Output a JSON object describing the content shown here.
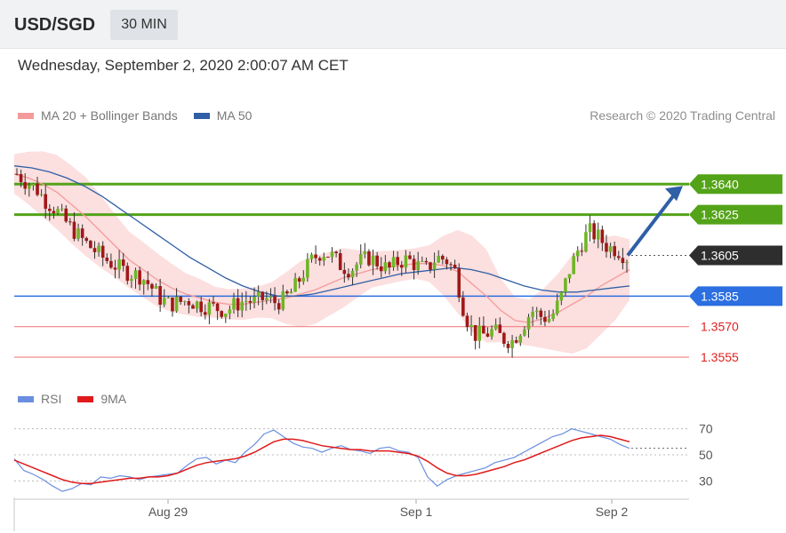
{
  "header": {
    "symbol": "USD/SGD",
    "timeframe": "30 MIN"
  },
  "datetime": "Wednesday, September 2, 2020 2:00:07 AM CET",
  "legend": {
    "ma20": {
      "label": "MA 20 + Bollinger Bands",
      "color": "#f49a9a"
    },
    "ma50": {
      "label": "MA 50",
      "color": "#2f5fa6"
    }
  },
  "research": "Research © 2020 Trading Central",
  "rsi_legend": {
    "rsi": {
      "label": "RSI",
      "color": "#6a8ee0"
    },
    "ma9": {
      "label": "9MA",
      "color": "#e01a1a"
    }
  },
  "colors": {
    "resistance": "#53a318",
    "pivot": "#2b6fe0",
    "support": "#f08080",
    "support_text": "#e02020",
    "up": "#6fb526",
    "down": "#a01818",
    "arrow": "#2f5fa6"
  },
  "chart_data": [
    {
      "type": "candlestick",
      "title": "USD/SGD 30 MIN",
      "ylim": [
        1.3545,
        1.3665
      ],
      "current_price": 1.3605,
      "levels": [
        {
          "price": 1.364,
          "label": "1.3640",
          "kind": "resistance"
        },
        {
          "price": 1.3625,
          "label": "1.3625",
          "kind": "resistance"
        },
        {
          "price": 1.3605,
          "label": "1.3605",
          "kind": "current"
        },
        {
          "price": 1.3585,
          "label": "1.3585",
          "kind": "pivot"
        },
        {
          "price": 1.357,
          "label": "1.3570",
          "kind": "support"
        },
        {
          "price": 1.3555,
          "label": "1.3555",
          "kind": "support"
        }
      ],
      "xtick_labels": [
        "Aug 29",
        "Sep 1",
        "Sep 2"
      ],
      "close_path": [
        1.3645,
        1.3641,
        1.3638,
        1.3632,
        1.3628,
        1.3622,
        1.3617,
        1.3612,
        1.3608,
        1.3604,
        1.3601,
        1.3598,
        1.3596,
        1.3595,
        1.359,
        1.3584,
        1.3581,
        1.3582,
        1.3583,
        1.3581,
        1.358,
        1.3579,
        1.3578,
        1.3581,
        1.3583,
        1.3582,
        1.3584,
        1.3582,
        1.3583,
        1.3588,
        1.3596,
        1.3603,
        1.3607,
        1.3605,
        1.36,
        1.3598,
        1.3602,
        1.3604,
        1.3601,
        1.3598,
        1.3602,
        1.3603,
        1.36,
        1.3598,
        1.3604,
        1.3603,
        1.3597,
        1.3576,
        1.3566,
        1.3566,
        1.3568,
        1.3564,
        1.3563,
        1.357,
        1.3578,
        1.3575,
        1.3574,
        1.3583,
        1.3598,
        1.3609,
        1.3617,
        1.3614,
        1.3609,
        1.3608,
        1.3604
      ],
      "ma20_points": [
        1.3645,
        1.3643,
        1.364,
        1.3636,
        1.363,
        1.3624,
        1.3617,
        1.361,
        1.3603,
        1.3598,
        1.3593,
        1.3589,
        1.3586,
        1.3584,
        1.3582,
        1.3581,
        1.3581,
        1.3582,
        1.3583,
        1.3584,
        1.3586,
        1.3588,
        1.3591,
        1.3594,
        1.3596,
        1.3598,
        1.3599,
        1.36,
        1.3601,
        1.3601,
        1.36,
        1.3597,
        1.3591,
        1.3585,
        1.3578,
        1.3573,
        1.3572,
        1.3574,
        1.3577,
        1.3581,
        1.3585,
        1.359,
        1.3594,
        1.3598
      ],
      "ma50_points": [
        1.3649,
        1.3648,
        1.3646,
        1.3643,
        1.3639,
        1.3634,
        1.3628,
        1.3622,
        1.3616,
        1.361,
        1.3604,
        1.3599,
        1.3594,
        1.359,
        1.3587,
        1.3585,
        1.3585,
        1.3586,
        1.3588,
        1.359,
        1.3592,
        1.3594,
        1.3596,
        1.3597,
        1.3598,
        1.3599,
        1.3598,
        1.3596,
        1.3593,
        1.359,
        1.3588,
        1.3587,
        1.3587,
        1.3588,
        1.3589,
        1.359
      ],
      "forecast_arrow": {
        "from": 1.3605,
        "to": 1.364
      }
    },
    {
      "type": "line",
      "title": "RSI",
      "yticks": [
        70,
        50,
        30
      ],
      "ylim": [
        20,
        80
      ],
      "series": [
        {
          "name": "RSI",
          "values": [
            47,
            38,
            35,
            31,
            26,
            22,
            24,
            28,
            27,
            33,
            32,
            34,
            33,
            31,
            33,
            34,
            35,
            36,
            42,
            47,
            48,
            43,
            46,
            44,
            52,
            58,
            66,
            69,
            64,
            59,
            56,
            55,
            52,
            55,
            57,
            54,
            53,
            51,
            55,
            56,
            53,
            52,
            48,
            33,
            26,
            31,
            34,
            36,
            38,
            40,
            44,
            46,
            48,
            52,
            56,
            60,
            64,
            66,
            70,
            68,
            66,
            64,
            62,
            58,
            55
          ]
        },
        {
          "name": "9MA",
          "values": [
            46,
            43,
            40,
            37,
            34,
            31,
            29,
            28,
            28,
            29,
            30,
            31,
            32,
            32,
            33,
            33,
            34,
            36,
            39,
            42,
            44,
            45,
            46,
            47,
            49,
            52,
            56,
            60,
            62,
            62,
            61,
            59,
            57,
            56,
            55,
            54,
            54,
            53,
            53,
            53,
            52,
            51,
            49,
            45,
            40,
            36,
            34,
            34,
            35,
            37,
            39,
            41,
            44,
            46,
            49,
            52,
            55,
            58,
            61,
            63,
            64,
            65,
            64,
            62,
            60
          ]
        }
      ]
    }
  ]
}
